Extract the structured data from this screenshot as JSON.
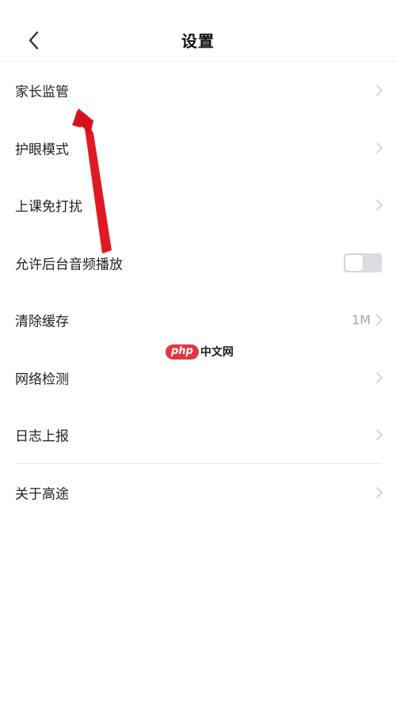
{
  "header": {
    "title": "设置",
    "back_icon": "back-chevron-icon"
  },
  "rows": [
    {
      "label": "家长监管",
      "control": "chevron"
    },
    {
      "label": "护眼模式",
      "control": "chevron"
    },
    {
      "label": "上课免打扰",
      "control": "chevron"
    },
    {
      "label": "允许后台音频播放",
      "control": "toggle",
      "toggle_on": false
    },
    {
      "label": "清除缓存",
      "control": "chevron",
      "value": "1M"
    },
    {
      "label": "网络检测",
      "control": "chevron"
    },
    {
      "label": "日志上报",
      "control": "chevron"
    },
    {
      "label": "关于高途",
      "control": "chevron"
    }
  ],
  "watermark": {
    "badge": "php",
    "text": "中文网"
  },
  "colors": {
    "background": "#ffffff",
    "text": "#222222",
    "secondary_text": "#a7a7a7",
    "annotation_arrow": "#e0141e",
    "toggle_off": "#dcdde3"
  }
}
